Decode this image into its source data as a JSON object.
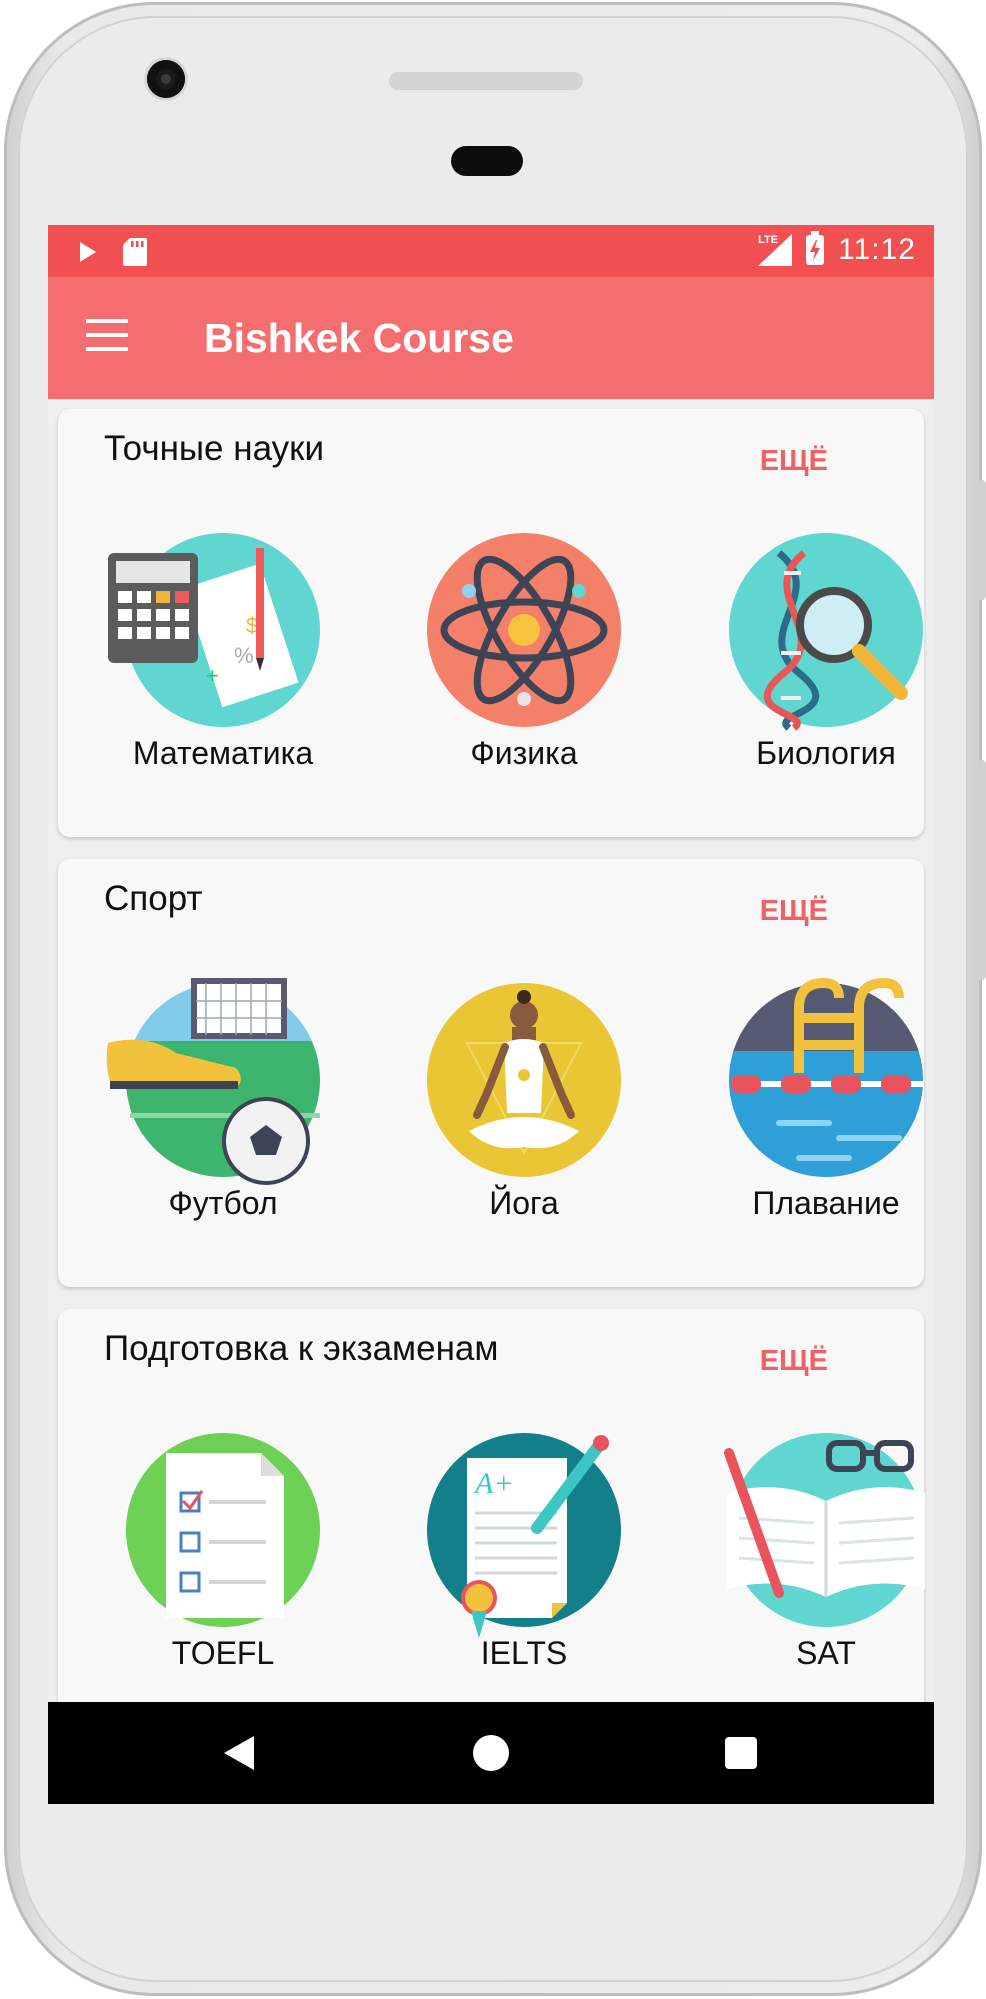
{
  "status_bar": {
    "time": "11:12",
    "network": "LTE",
    "icons": [
      "play-icon",
      "sd-card-icon",
      "lte-signal-icon",
      "battery-charging-icon"
    ]
  },
  "app_bar": {
    "title": "Bishkek Course",
    "menu_icon": "hamburger-menu-icon"
  },
  "sections": [
    {
      "title": "Точные науки",
      "more_label": "ЕЩЁ",
      "items": [
        {
          "label": "Математика",
          "icon": "calculator-icon",
          "color": "#5fd6cf"
        },
        {
          "label": "Физика",
          "icon": "atom-icon",
          "color": "#f4806a"
        },
        {
          "label": "Биология",
          "icon": "dna-magnifier-icon",
          "color": "#5fd6cf"
        }
      ]
    },
    {
      "title": "Спорт",
      "more_label": "ЕЩЁ",
      "items": [
        {
          "label": "Футбол",
          "icon": "football-icon",
          "color": "#3eb56f"
        },
        {
          "label": "Йога",
          "icon": "yoga-icon",
          "color": "#eac534"
        },
        {
          "label": "Плавание",
          "icon": "swimming-pool-icon",
          "color": "#2f9fd8"
        }
      ]
    },
    {
      "title": "Подготовка к экзаменам",
      "more_label": "ЕЩЁ",
      "items": [
        {
          "label": "TOEFL",
          "icon": "checklist-icon",
          "color": "#6cd155"
        },
        {
          "label": "IELTS",
          "icon": "certificate-icon",
          "color": "#127f8a"
        },
        {
          "label": "SAT",
          "icon": "open-book-icon",
          "color": "#5fd6cf"
        }
      ]
    }
  ],
  "accent_color": "#f46e70"
}
